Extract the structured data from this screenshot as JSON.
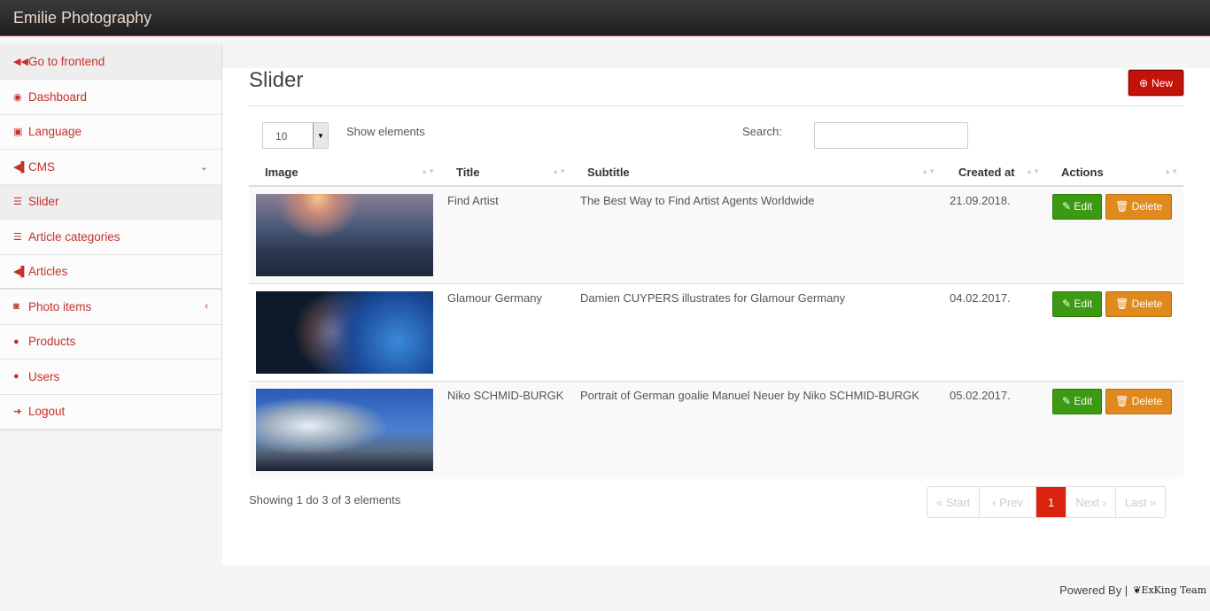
{
  "app": {
    "title": "Emilie Photography"
  },
  "sidebar": {
    "items": [
      {
        "label": "Go to frontend",
        "icon": "backward-icon"
      },
      {
        "label": "Dashboard",
        "icon": "dashboard-icon"
      },
      {
        "label": "Language",
        "icon": "language-icon"
      },
      {
        "label": "CMS",
        "icon": "bullhorn-icon",
        "chevron": "⌄"
      },
      {
        "label": "Slider",
        "icon": "list-icon"
      },
      {
        "label": "Article categories",
        "icon": "list-icon"
      },
      {
        "label": "Articles",
        "icon": "bullhorn-icon"
      },
      {
        "label": "Photo items",
        "icon": "camera-icon",
        "chevron": "‹"
      },
      {
        "label": "Products",
        "icon": "user-icon"
      },
      {
        "label": "Users",
        "icon": "user-icon"
      },
      {
        "label": "Logout",
        "icon": "sign-out-icon"
      }
    ]
  },
  "page": {
    "title": "Slider",
    "new_label": "New"
  },
  "controls": {
    "page_size": "10",
    "show_label": "Show elements",
    "search_label": "Search:",
    "search_value": ""
  },
  "table": {
    "headers": [
      "Image",
      "Title",
      "Subtitle",
      "Created at",
      "Actions"
    ],
    "rows": [
      {
        "title": "Find Artist",
        "subtitle": "The Best Way to Find Artist Agents Worldwide",
        "created": "21.09.2018.",
        "edit": "Edit",
        "delete": "Delete"
      },
      {
        "title": "Glamour Germany",
        "subtitle": "Damien CUYPERS illustrates for Glamour Germany",
        "created": "04.02.2017.",
        "edit": "Edit",
        "delete": "Delete"
      },
      {
        "title": "Niko SCHMID-BURGK",
        "subtitle": "Portrait of German goalie Manuel Neuer by Niko SCHMID-BURGK",
        "created": "05.02.2017.",
        "edit": "Edit",
        "delete": "Delete"
      }
    ]
  },
  "pagination": {
    "info": "Showing 1 do 3 of 3 elements",
    "start": "« Start",
    "prev": "‹ Prev",
    "current": "1",
    "next": "Next ›",
    "last": "Last »"
  },
  "footer": {
    "powered": "Powered By |",
    "brand": "ExKing Team"
  },
  "colors": {
    "accent": "#c4302b",
    "edit": "#3c9a12",
    "delete": "#e08a1e"
  }
}
